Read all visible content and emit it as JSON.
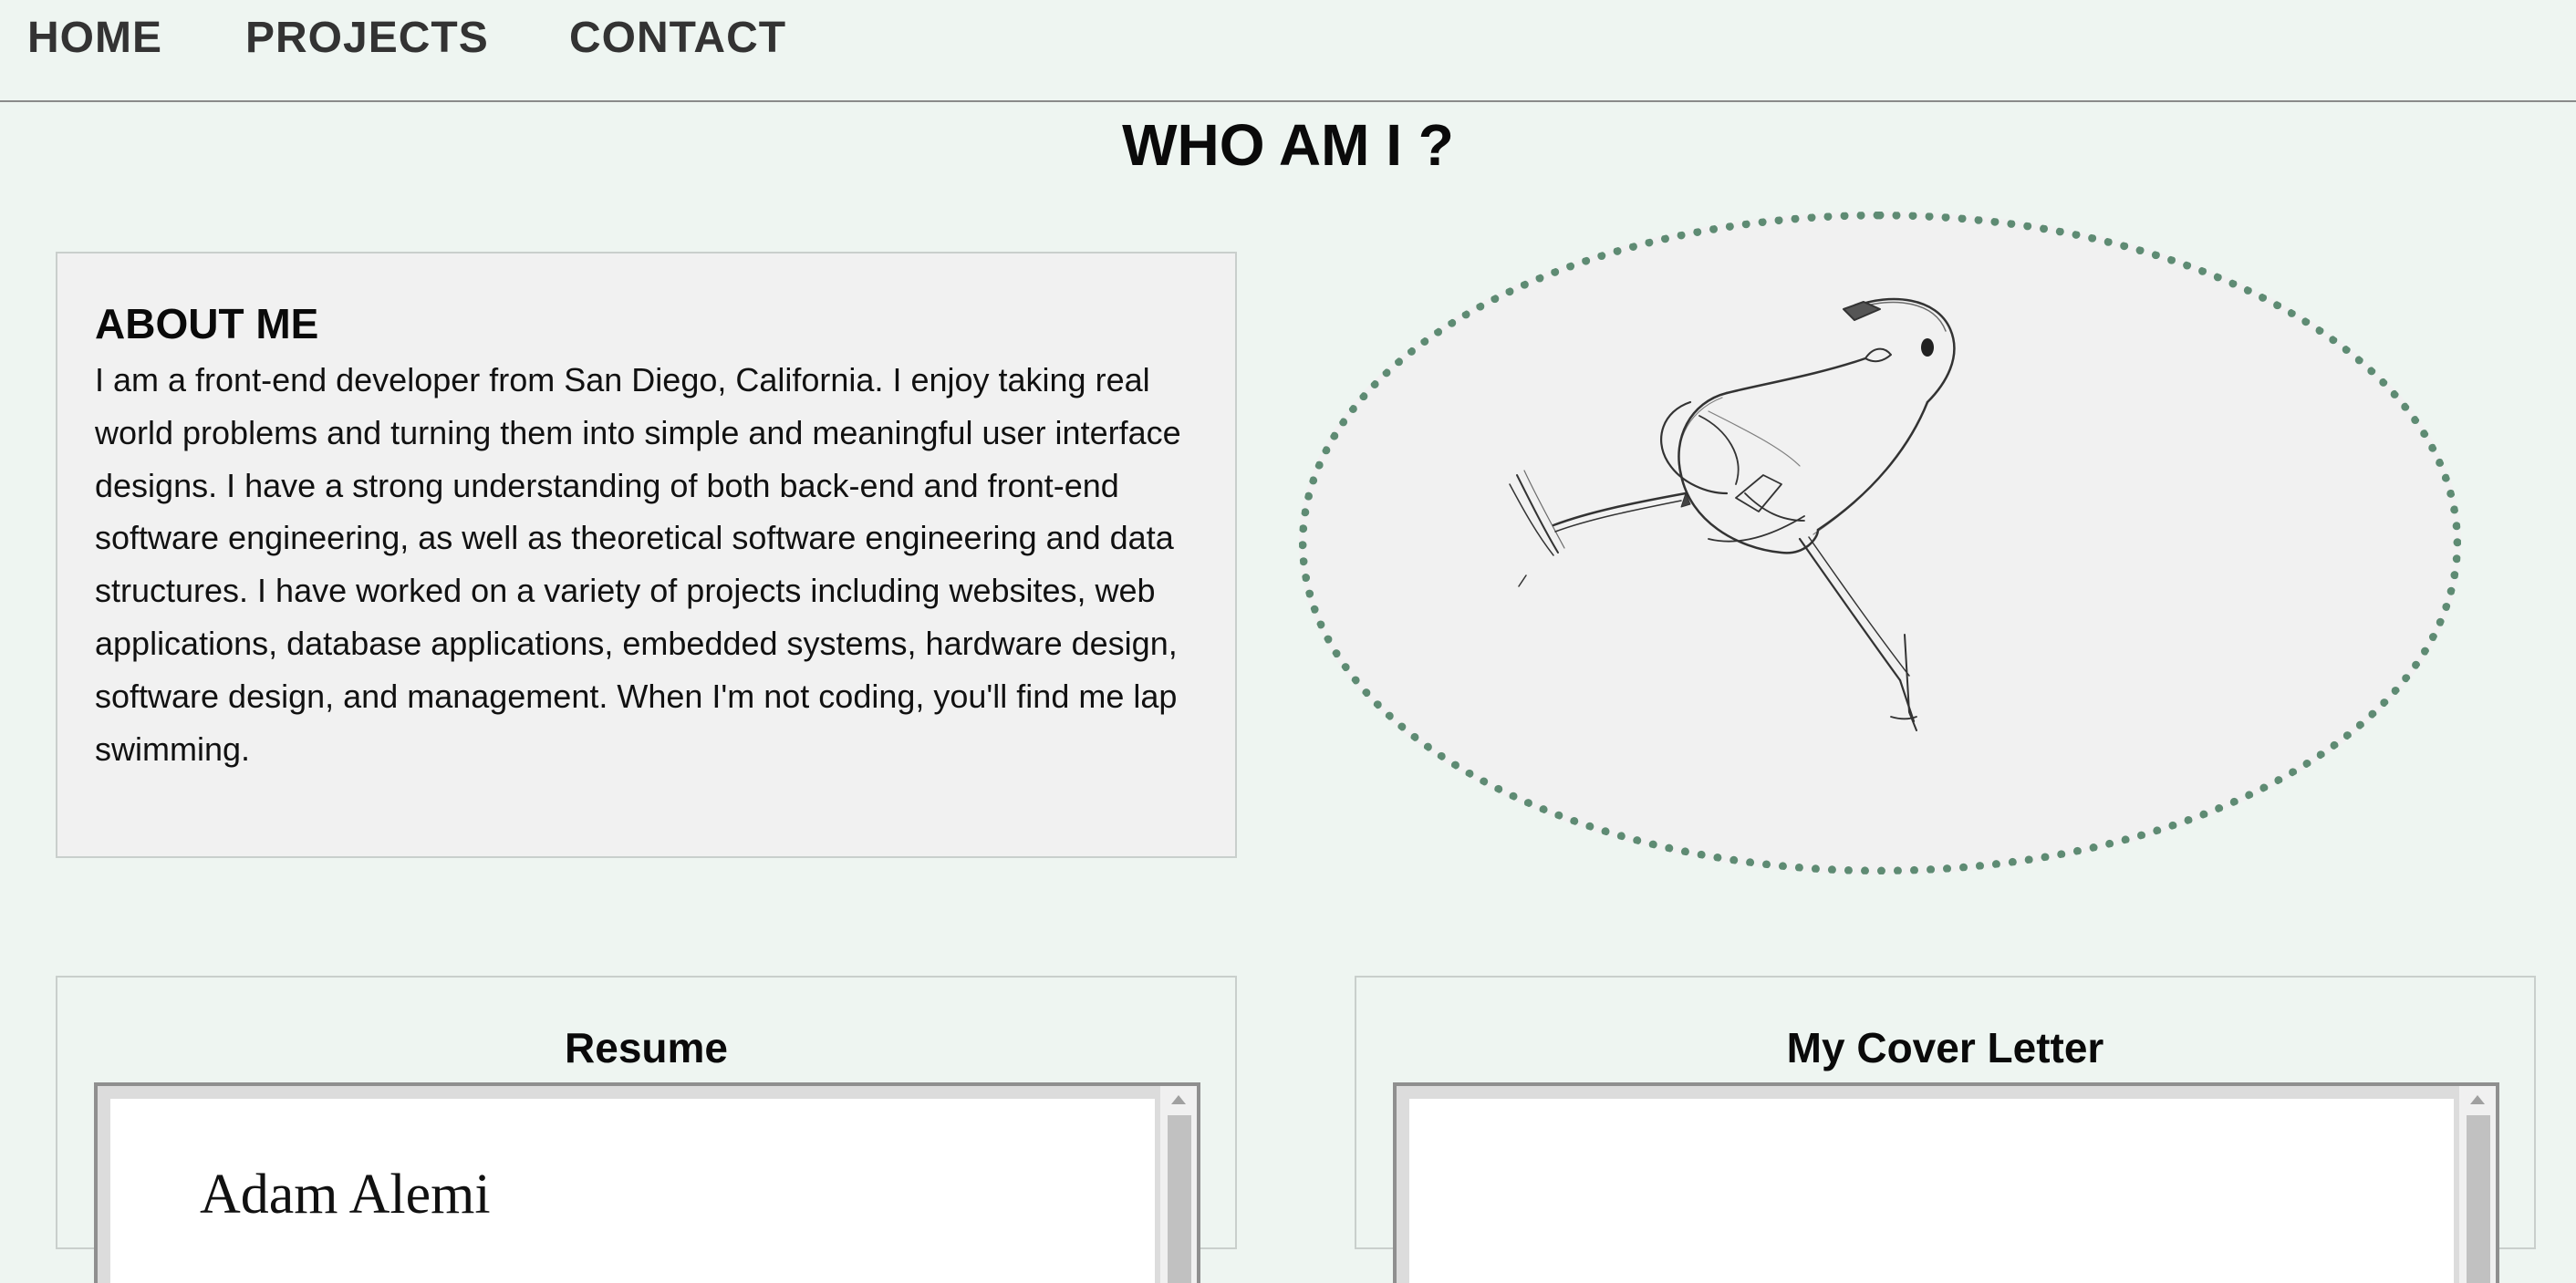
{
  "nav": {
    "items": [
      {
        "label": "HOME"
      },
      {
        "label": "PROJECTS"
      },
      {
        "label": "CONTACT"
      }
    ]
  },
  "page": {
    "title": "WHO AM I ?"
  },
  "about": {
    "heading": "ABOUT ME",
    "text": "I am a front-end developer from San Diego, California. I enjoy taking real world problems and turning them into simple and meaningful user interface designs. I have a strong understanding of both back-end and front-end software engineering, as well as theoretical software engineering and data structures. I have worked on a variety of projects including websites, web applications, database applications, embedded systems, hardware design, software design, and management. When I'm not coding, you'll find me lap swimming."
  },
  "portrait": {
    "icon": "bird-sketch-illustration",
    "border_color": "#5e8b73"
  },
  "resume": {
    "title": "Resume",
    "document_name": "Adam Alemi"
  },
  "cover_letter": {
    "title": "My Cover Letter"
  },
  "colors": {
    "background": "#eef5f1",
    "panel": "#f1f1f1",
    "accent": "#5e8b73"
  }
}
